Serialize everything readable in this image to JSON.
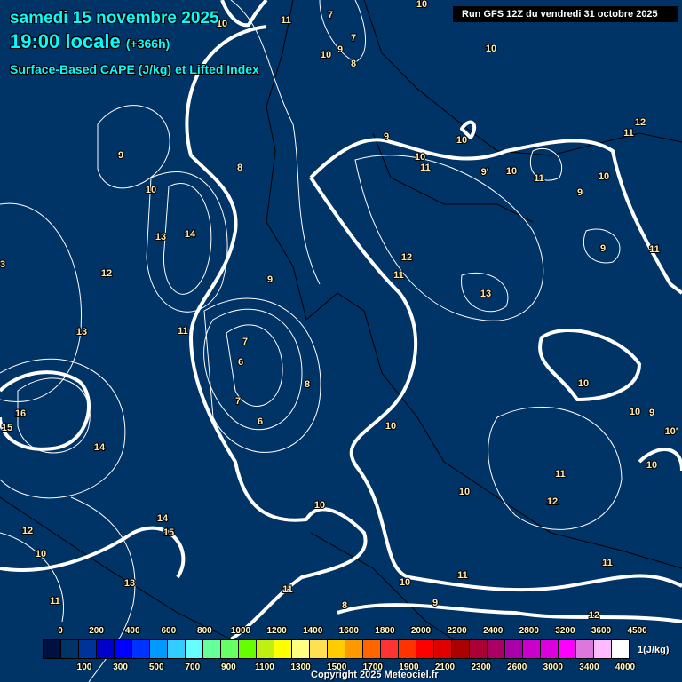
{
  "header": {
    "date": "samedi 15 novembre 2025",
    "time": "19:00 locale",
    "lead": "(+366h)",
    "parameter": "Surface-Based CAPE (J/kg) et Lifted Index",
    "run": "Run GFS 12Z du vendredi 31 octobre 2025"
  },
  "map": {
    "contour_labels": [
      "11",
      "10",
      "7",
      "7",
      "9",
      "10",
      "8",
      "10",
      "10",
      "12",
      "11",
      "10",
      "9",
      "10",
      "11",
      "9'",
      "10",
      "11",
      "10",
      "9",
      "9",
      "8",
      "10",
      "14",
      "13",
      "9",
      "11",
      "12",
      "11",
      "3",
      "12",
      "9",
      "13",
      "13",
      "11",
      "7",
      "6",
      "8",
      "10",
      "7",
      "16",
      "10",
      "9",
      "6",
      "15",
      "10",
      "10'",
      "14",
      "10",
      "11",
      "10",
      "12",
      "10",
      "14",
      "15",
      "12",
      "10",
      "11",
      "13",
      "10",
      "11",
      "11",
      "11",
      "9",
      "8",
      "12"
    ]
  },
  "legend": {
    "colors": [
      "#001040",
      "#003366",
      "#003399",
      "#0000cc",
      "#0000ff",
      "#0033ff",
      "#0099ff",
      "#33ccff",
      "#66ffff",
      "#66ff99",
      "#66ff66",
      "#66ff00",
      "#c0f010",
      "#ffff00",
      "#ffff80",
      "#ffe050",
      "#ffcc00",
      "#ff9900",
      "#ff6600",
      "#ff3333",
      "#ff3300",
      "#ff0000",
      "#e00000",
      "#aa0000",
      "#aa0033",
      "#aa0066",
      "#aa00aa",
      "#cc00cc",
      "#dd00dd",
      "#ff00ff",
      "#dd77dd",
      "#ffbbff",
      "#ffffff"
    ],
    "top_ticks": [
      "0",
      "200",
      "400",
      "600",
      "800",
      "1000",
      "1200",
      "1400",
      "1600",
      "1800",
      "2000",
      "2200",
      "2400",
      "2800",
      "3200",
      "3600",
      "4500"
    ],
    "bottom_ticks": [
      "100",
      "300",
      "500",
      "700",
      "900",
      "1100",
      "1300",
      "1500",
      "1700",
      "1900",
      "2100",
      "2300",
      "2600",
      "3000",
      "3400",
      "4000"
    ],
    "unit": "1(J/kg)"
  },
  "footer": {
    "copyright": "Copyright 2025 Meteociel.fr"
  }
}
